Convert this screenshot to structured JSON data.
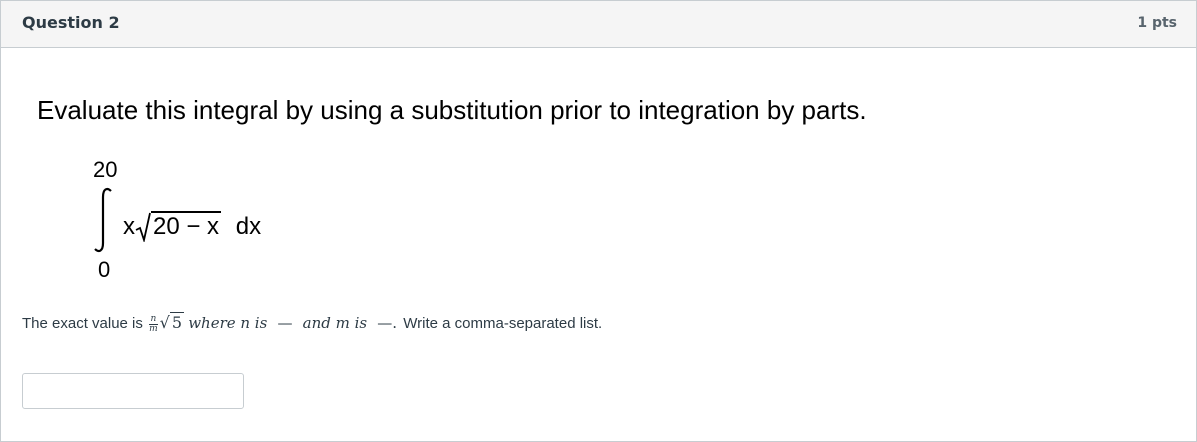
{
  "question": {
    "title": "Question 2",
    "points": "1 pts",
    "prompt": "Evaluate this integral by using a substitution prior to integration by parts."
  },
  "integral": {
    "upper_limit": "20",
    "lower_limit": "0",
    "integrand_prefix": "x",
    "radicand": "20 − x",
    "differential": "dx"
  },
  "answer_line": {
    "lead": "The exact value is",
    "frac_num": "n",
    "frac_den": "m",
    "sqrt_arg": "5",
    "where_text": "where n is",
    "blank1": "—",
    "and_text": "and m is",
    "blank2": "—.",
    "instruction": "Write a comma-separated list."
  },
  "answer": {
    "value": "",
    "placeholder": ""
  }
}
